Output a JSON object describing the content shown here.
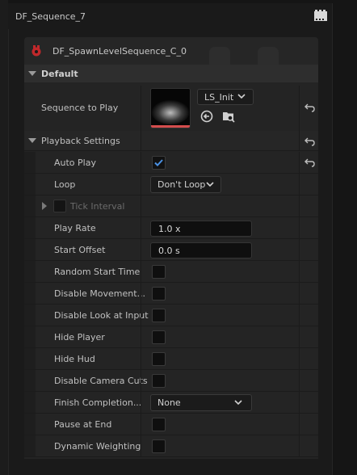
{
  "window": {
    "title": "DF_Sequence_7"
  },
  "header": {
    "object_name": "DF_SpawnLevelSequence_C_0"
  },
  "categories": {
    "default": "Default",
    "playback_settings": "Playback Settings"
  },
  "sequence_to_play": {
    "label": "Sequence to Play",
    "asset": "LS_Init"
  },
  "properties": {
    "auto_play": {
      "label": "Auto Play",
      "checked": true
    },
    "loop": {
      "label": "Loop",
      "value": "Don't Loop"
    },
    "tick_interval": {
      "label": "Tick Interval"
    },
    "play_rate": {
      "label": "Play Rate",
      "value": "1.0 x"
    },
    "start_offset": {
      "label": "Start Offset",
      "value": "0.0 s"
    },
    "random_start_time": {
      "label": "Random Start Time"
    },
    "disable_movement": {
      "label": "Disable Movement..."
    },
    "disable_look_at_input": {
      "label": "Disable Look at Input"
    },
    "hide_player": {
      "label": "Hide Player"
    },
    "hide_hud": {
      "label": "Hide Hud"
    },
    "disable_camera_cuts": {
      "label": "Disable Camera Cuts"
    },
    "finish_completion": {
      "label": "Finish Completion...",
      "value": "None"
    },
    "pause_at_end": {
      "label": "Pause at End"
    },
    "dynamic_weighting": {
      "label": "Dynamic Weighting"
    }
  },
  "colors": {
    "accent": "#4a90e2",
    "thumbnail_bar": "#d44d4d"
  },
  "icons": [
    "film-sequence-icon",
    "blueprint-object-icon",
    "reset-arrow-icon",
    "chevron-down-icon",
    "use-selected-arrow-icon",
    "browse-folder-icon",
    "checkmark-icon"
  ]
}
